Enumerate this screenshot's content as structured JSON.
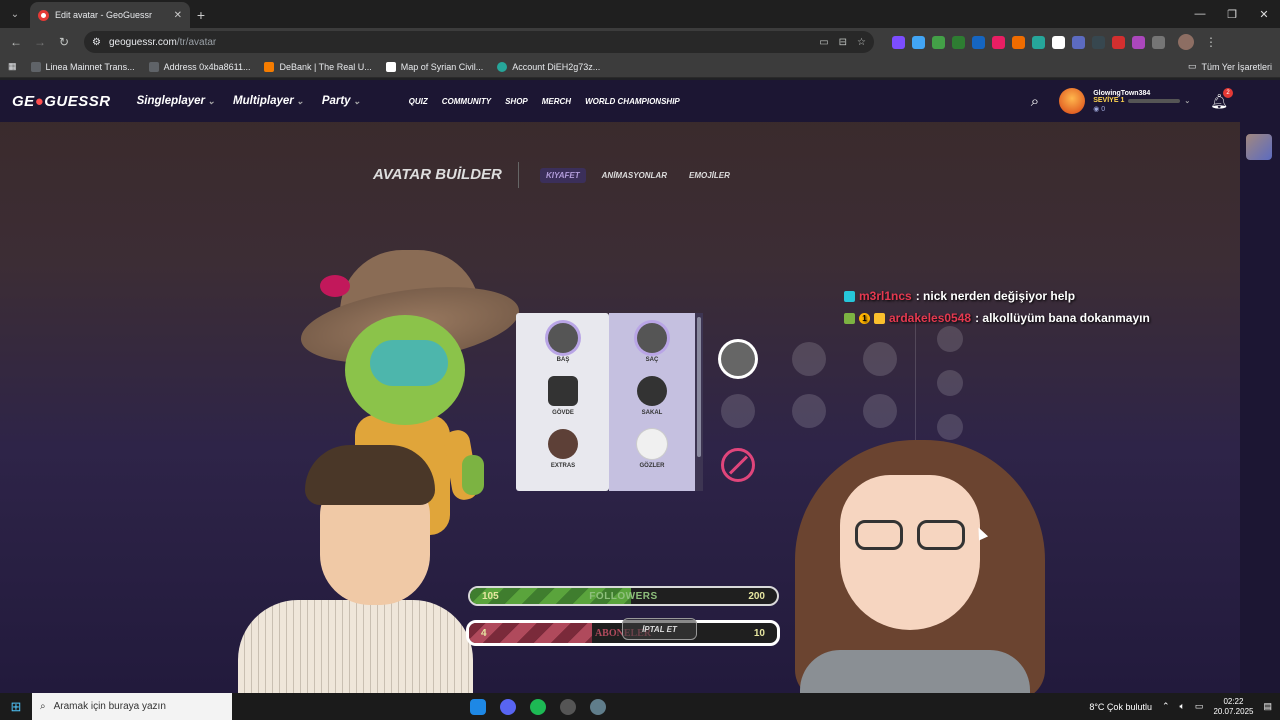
{
  "browser": {
    "tab_title": "Edit avatar - GeoGuessr",
    "url_host": "geoguessr.com",
    "url_path": "/tr/avatar",
    "bookmarks": [
      {
        "label": "Linea Mainnet Trans..."
      },
      {
        "label": "Address 0x4ba8611..."
      },
      {
        "label": "DeBank | The Real U..."
      },
      {
        "label": "Map of Syrian Civil..."
      },
      {
        "label": "Account DiEH2g73z..."
      }
    ],
    "all_bookmarks": "Tüm Yer İşaretleri"
  },
  "site": {
    "logo_pre": "GE",
    "logo_mid": "●",
    "logo_post": "GUESSR",
    "nav_main": [
      "Singleplayer",
      "Multiplayer",
      "Party"
    ],
    "nav_sub": [
      "QUIZ",
      "COMMUNITY",
      "SHOP",
      "MERCH",
      "WORLD CHAMPIONSHIP"
    ],
    "user": {
      "name": "GlowingTown384",
      "level": "SEVİYE 1",
      "coins": "0"
    },
    "notifications": "2"
  },
  "avatar_builder": {
    "title": "AVATAR BUİLDER",
    "tabs": [
      "KIYAFET",
      "ANİMASYONLAR",
      "EMOJİLER"
    ],
    "categories_left": [
      "BAŞ",
      "GÖVDE",
      "EXTRAS"
    ],
    "categories_right": [
      "SAÇ",
      "SAKAL",
      "GÖZLER"
    ]
  },
  "chat": [
    {
      "user": "m3rl1ncs",
      "message": ": nick nerden değişiyor help"
    },
    {
      "user": "ardakeles0548",
      "badge": "1",
      "message": ": alkollüyüm bana dokanmayın"
    }
  ],
  "overlay": {
    "followers": {
      "label": "FOLLOWERS",
      "current": "105",
      "goal": "200",
      "progress": 0.525
    },
    "subs": {
      "label": "ABONELER",
      "current": "4",
      "goal": "10",
      "progress": 0.4
    },
    "cancel": "İPTAL ET"
  },
  "taskbar": {
    "search_placeholder": "Aramak için buraya yazın",
    "weather": "8°C  Çok bulutlu",
    "time": "02:22",
    "date": "20.07.2025"
  }
}
